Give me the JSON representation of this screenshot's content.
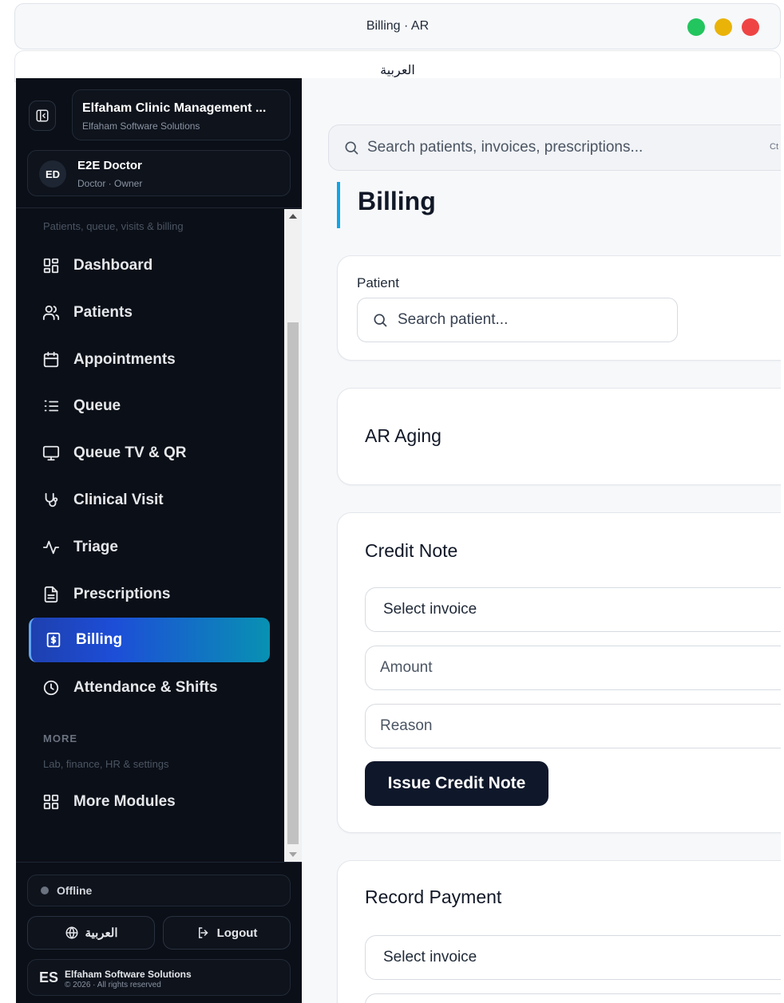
{
  "window": {
    "title": "Billing · AR",
    "language_label": "العربية"
  },
  "sidebar": {
    "brand_name": "Elfaham Clinic Management ...",
    "brand_sub": "Elfaham Software Solutions",
    "user_initials": "ED",
    "user_name": "E2E Doctor",
    "user_role": "Doctor · Owner",
    "section1_sub": "Patients, queue, visits & billing",
    "items": [
      {
        "label": "Dashboard",
        "icon": "dashboard-icon"
      },
      {
        "label": "Patients",
        "icon": "users-icon"
      },
      {
        "label": "Appointments",
        "icon": "calendar-icon"
      },
      {
        "label": "Queue",
        "icon": "list-ordered-icon"
      },
      {
        "label": "Queue TV & QR",
        "icon": "monitor-icon"
      },
      {
        "label": "Clinical Visit",
        "icon": "stethoscope-icon"
      },
      {
        "label": "Triage",
        "icon": "activity-icon"
      },
      {
        "label": "Prescriptions",
        "icon": "file-text-icon"
      },
      {
        "label": "Billing",
        "icon": "receipt-dollar-icon",
        "active": true
      },
      {
        "label": "Attendance & Shifts",
        "icon": "clock-icon"
      }
    ],
    "section2_title": "MORE",
    "section2_sub": "Lab, finance, HR & settings",
    "more_item": {
      "label": "More Modules",
      "icon": "grid-icon"
    },
    "status_text": "Offline",
    "language_button": "العربية",
    "logout_button": "Logout",
    "company_logo": "ES",
    "company_name": "Elfaham Software Solutions",
    "copyright": "© 2026 · All rights reserved"
  },
  "main": {
    "search_placeholder": "Search patients, invoices, prescriptions...",
    "search_shortcut": "Ct",
    "page_title": "Billing",
    "patient_label": "Patient",
    "patient_search_placeholder": "Search patient...",
    "ar_aging_title": "AR Aging",
    "credit_note": {
      "title": "Credit Note",
      "select_invoice": "Select invoice",
      "amount_placeholder": "Amount",
      "reason_placeholder": "Reason",
      "button": "Issue Credit Note"
    },
    "record_payment": {
      "title": "Record Payment",
      "select_invoice": "Select invoice"
    }
  },
  "colors": {
    "accent": "#0ea5e9",
    "active_nav_start": "#1e40af",
    "active_nav_end": "#0891b2",
    "sidebar_bg": "#0b0f17",
    "primary_button": "#0f172a"
  }
}
